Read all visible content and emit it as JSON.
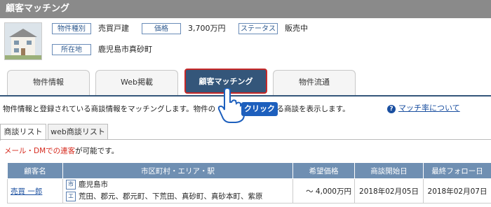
{
  "window": {
    "title": "顧客マッチング"
  },
  "property": {
    "type_label": "物件種別",
    "type_value": "売買戸建",
    "price_label": "価格",
    "price_value": "3,700万円",
    "status_label": "ステータス",
    "status_value": "販売中",
    "location_label": "所在地",
    "location_value": "鹿児島市真砂町"
  },
  "tabs": [
    {
      "label": "物件情報"
    },
    {
      "label": "Web掲載"
    },
    {
      "label": "顧客マッチング"
    },
    {
      "label": "物件流通"
    }
  ],
  "description": "物件情報と登録されている商談情報をマッチングします。物件の",
  "description_tail": "ッチする商談を表示します。",
  "click_label": "クリック",
  "help_link": "マッチ率について",
  "subtabs": [
    {
      "label": "商談リスト"
    },
    {
      "label": "web商談リスト"
    }
  ],
  "mail_notice": {
    "red": "メール・DMでの連客",
    "black": "が可能です。"
  },
  "table": {
    "headers": [
      "顧客名",
      "市区町村・エリア・駅",
      "希望価格",
      "商談開始日",
      "最終フォロー日"
    ],
    "rows": [
      {
        "customer": "売買 一郎",
        "city_badge": "市",
        "city": "鹿児島市",
        "area_badge": "エ",
        "areas": "荒田、郡元、郡元町、下荒田、真砂町、真砂本町、紫原",
        "price": "～ 4,000万円",
        "start": "2018年02月05日",
        "follow": "2018年02月07日"
      }
    ]
  },
  "colors": {
    "accent": "#34567a",
    "highlight": "#c62828",
    "link": "#1a4fa0",
    "header": "#6f8fb2"
  }
}
